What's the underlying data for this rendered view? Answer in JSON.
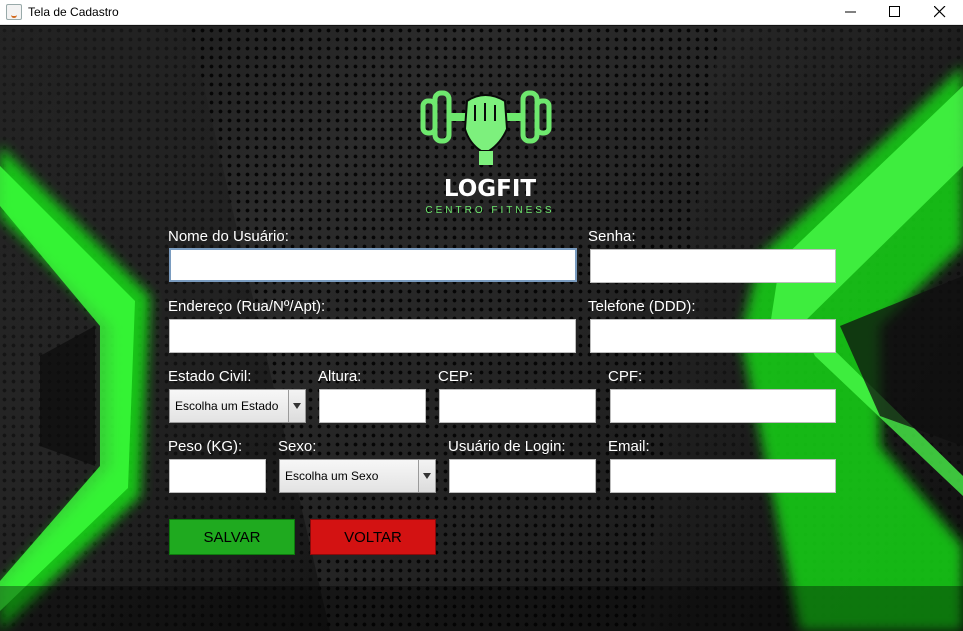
{
  "window": {
    "title": "Tela de Cadastro",
    "app_icon": "java-cup-icon",
    "controls": [
      "minimize-icon",
      "maximize-icon",
      "close-icon"
    ]
  },
  "logo": {
    "name": "LOGFIT",
    "tagline": "CENTRO FITNESS",
    "icon": "dumbbell-fist-icon",
    "accent_color": "#6ee86e"
  },
  "form": {
    "nome": {
      "label": "Nome do Usuário:",
      "value": ""
    },
    "senha": {
      "label": "Senha:",
      "value": ""
    },
    "endereco": {
      "label": "Endereço (Rua/Nº/Apt):",
      "value": ""
    },
    "telefone": {
      "label": "Telefone (DDD):",
      "value": ""
    },
    "estado_civil": {
      "label": "Estado Civil:",
      "selected": "Escolha um Estado"
    },
    "altura": {
      "label": "Altura:",
      "value": ""
    },
    "cep": {
      "label": "CEP:",
      "value": ""
    },
    "cpf": {
      "label": "CPF:",
      "value": ""
    },
    "peso": {
      "label": "Peso (KG):",
      "value": ""
    },
    "sexo": {
      "label": "Sexo:",
      "selected": "Escolha um Sexo"
    },
    "usuario_login": {
      "label": "Usuário de Login:",
      "value": ""
    },
    "email": {
      "label": "Email:",
      "value": ""
    }
  },
  "buttons": {
    "save": {
      "label": "SALVAR",
      "color": "#1faa1f"
    },
    "back": {
      "label": "VOLTAR",
      "color": "#d31212"
    }
  }
}
